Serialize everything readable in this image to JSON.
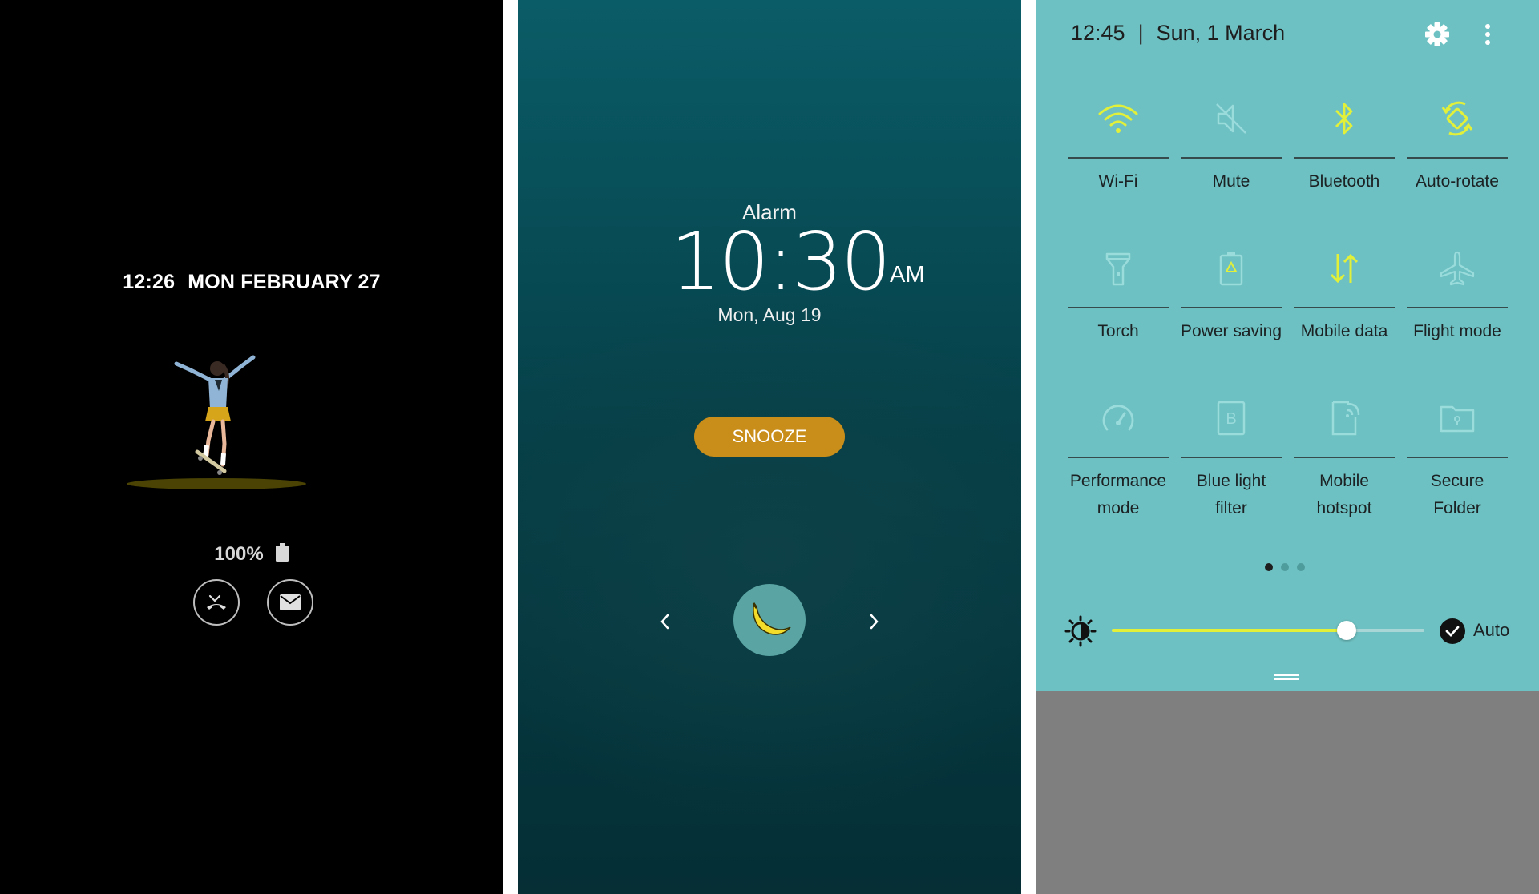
{
  "aod": {
    "time": "12:26",
    "date": "MON FEBRUARY 27",
    "battery": "100%",
    "notifications": [
      "missed-call-icon",
      "message-icon"
    ]
  },
  "alarm": {
    "label": "Alarm",
    "time": "10:30",
    "ampm": "AM",
    "date": "Mon, Aug 19",
    "snooze_label": "SNOOZE",
    "prev_icon": "chevron-left-icon",
    "next_icon": "chevron-right-icon",
    "dismiss_icon": "banana-icon"
  },
  "quick_panel": {
    "time": "12:45",
    "separator": "|",
    "date": "Sun, 1 March",
    "tiles": [
      {
        "label": "Wi-Fi",
        "icon": "wifi-icon",
        "active": true
      },
      {
        "label": "Mute",
        "icon": "mute-icon",
        "active": false
      },
      {
        "label": "Bluetooth",
        "icon": "bluetooth-icon",
        "active": true
      },
      {
        "label": "Auto-rotate",
        "icon": "auto-rotate-icon",
        "active": true
      },
      {
        "label": "Torch",
        "icon": "torch-icon",
        "active": false
      },
      {
        "label": "Power saving",
        "icon": "power-saving-icon",
        "active": false
      },
      {
        "label": "Mobile data",
        "icon": "mobile-data-icon",
        "active": true
      },
      {
        "label": "Flight mode",
        "icon": "flight-mode-icon",
        "active": false
      },
      {
        "label": "Performance mode",
        "icon": "performance-mode-icon",
        "active": false
      },
      {
        "label": "Blue light filter",
        "icon": "blue-light-filter-icon",
        "active": false
      },
      {
        "label": "Mobile hotspot",
        "icon": "mobile-hotspot-icon",
        "active": false
      },
      {
        "label": "Secure Folder",
        "icon": "secure-folder-icon",
        "active": false
      }
    ],
    "page_count": 3,
    "current_page": 1,
    "brightness": 0.75,
    "auto_label": "Auto",
    "auto_checked": true
  },
  "colors": {
    "qp_background": "#6ec1c2",
    "active_icon": "#e2f03a",
    "inactive_icon": "#9adbdc",
    "snooze": "#c98e1a"
  }
}
